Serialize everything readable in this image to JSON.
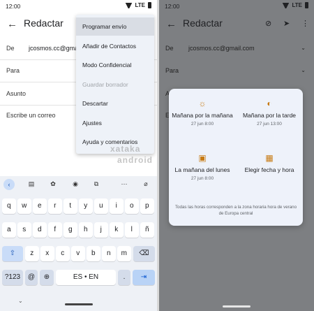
{
  "left": {
    "status": {
      "time": "12:00",
      "network": "LTE"
    },
    "app_title": "Redactar",
    "fields": {
      "from_label": "De",
      "from_value": "jcosmos.cc@gmai",
      "to_label": "Para",
      "subject_label": "Asunto",
      "body_placeholder": "Escribe un correo"
    },
    "menu": [
      {
        "label": "Programar envío",
        "selected": true,
        "disabled": false
      },
      {
        "label": "Añadir de Contactos",
        "selected": false,
        "disabled": false
      },
      {
        "label": "Modo Confidencial",
        "selected": false,
        "disabled": false
      },
      {
        "label": "Guardar borrador",
        "selected": false,
        "disabled": true
      },
      {
        "label": "Descartar",
        "selected": false,
        "disabled": false
      },
      {
        "label": "Ajustes",
        "selected": false,
        "disabled": false
      },
      {
        "label": "Ayuda y comentarios",
        "selected": false,
        "disabled": false
      }
    ],
    "keyboard": {
      "row1": [
        "q",
        "w",
        "e",
        "r",
        "t",
        "y",
        "u",
        "i",
        "o",
        "p"
      ],
      "row2": [
        "a",
        "s",
        "d",
        "f",
        "g",
        "h",
        "j",
        "k",
        "l",
        "ñ"
      ],
      "row3": [
        "z",
        "x",
        "c",
        "v",
        "b",
        "n",
        "m"
      ],
      "symbols_key": "?123",
      "at_key": "@",
      "space_label": "ES • EN",
      "period_key": "."
    },
    "watermark": {
      "line1": "xataka",
      "line2": "android"
    }
  },
  "right": {
    "status": {
      "time": "12:00",
      "network": "LTE"
    },
    "app_title": "Redactar",
    "fields": {
      "from_label": "De",
      "from_value": "jcosmos.cc@gmail.com",
      "to_label": "Para",
      "subject_initial": "A",
      "body_initial": "E"
    },
    "dialog": {
      "options": [
        {
          "label": "Mañana por la mañana",
          "time": "27 jun 8:00",
          "icon": "sun-icon"
        },
        {
          "label": "Mañana por la tarde",
          "time": "27 jun 13:00",
          "icon": "sun-half-icon"
        },
        {
          "label": "La mañana del lunes",
          "time": "27 jun 8:00",
          "icon": "briefcase-icon"
        },
        {
          "label": "Elegir fecha y hora",
          "time": "",
          "icon": "calendar-icon"
        }
      ],
      "note": "Todas las horas corresponden a la zona horaria hora de verano de Europa central"
    }
  },
  "colors": {
    "accent_orange": "#c77a12",
    "keyboard_bg": "#eef1f6",
    "menu_bg": "#eef2f8",
    "scrim": "#7d7f82"
  }
}
